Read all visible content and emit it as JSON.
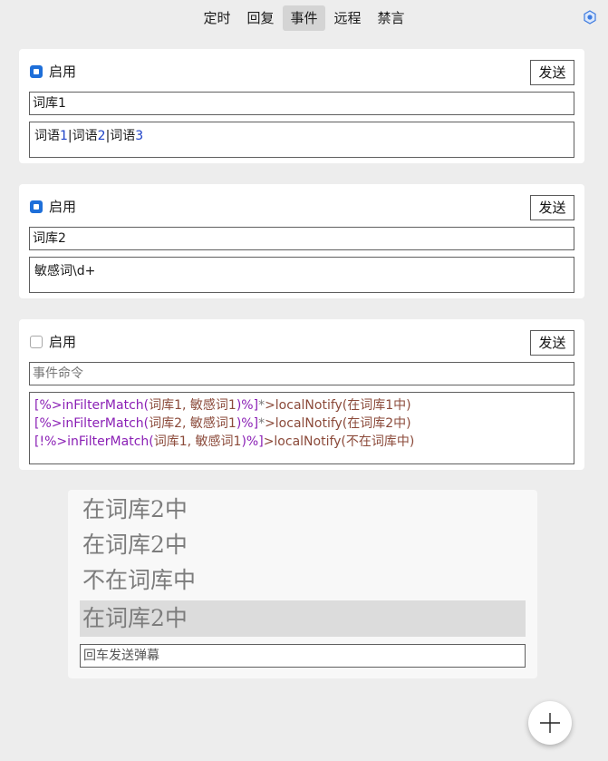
{
  "nav": {
    "tabs": [
      {
        "label": "定时"
      },
      {
        "label": "回复"
      },
      {
        "label": "事件",
        "active": true
      },
      {
        "label": "远程"
      },
      {
        "label": "禁言"
      }
    ]
  },
  "colors": {
    "accent": "#1e6fd9",
    "script_purple": "#8a1fb5",
    "script_brown": "#8b4a3a",
    "number_blue": "#1f43c8"
  },
  "cards": [
    {
      "enabled": true,
      "enable_label": "启用",
      "send_label": "发送",
      "name_value": "词库1",
      "content": {
        "seg1": "词语",
        "num1": "1",
        "seg2": "|词语",
        "num2": "2",
        "seg3": "|词语",
        "num3": "3"
      }
    },
    {
      "enabled": true,
      "enable_label": "启用",
      "send_label": "发送",
      "name_value": "词库2",
      "content_text": "敏感词\\d+"
    },
    {
      "enabled": false,
      "enable_label": "启用",
      "send_label": "发送",
      "name_placeholder": "事件命令",
      "script_lines": [
        {
          "a": "[%>inFilterMatch(",
          "b": "词库1, 敏感词1",
          "c": ")%]",
          "d": "*",
          "e": ">localNotify(在词库1中)"
        },
        {
          "a": "[%>inFilterMatch(",
          "b": "词库2, 敏感词1",
          "c": ")%]",
          "d": "*",
          "e": ">localNotify(在词库2中)"
        },
        {
          "a": "[!%>inFilterMatch(",
          "b": "词库1, 敏感词1",
          "c": ")%]",
          "d": "",
          "e": ">localNotify(不在词库中)"
        }
      ]
    }
  ],
  "danmaku": {
    "lines": [
      {
        "text": "在词库2中"
      },
      {
        "text": "在词库2中"
      },
      {
        "text": "不在词库中"
      },
      {
        "text": "在词库2中",
        "highlighted": true
      }
    ],
    "input_placeholder": "回车发送弹幕"
  },
  "fab": {
    "icon": "plus-icon"
  }
}
